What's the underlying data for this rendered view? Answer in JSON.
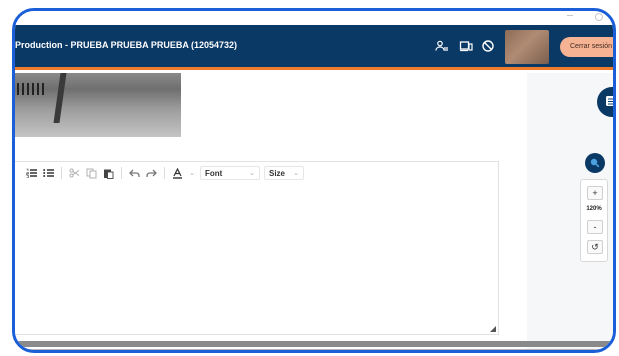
{
  "header": {
    "title": "Production - PRUEBA PRUEBA PRUEBA (12054732)",
    "logout_label": "Cerrar sesión",
    "icons": [
      "users-icon",
      "devices-icon",
      "block-icon"
    ]
  },
  "editor": {
    "toolbar": {
      "font_label": "Font",
      "size_label": "Size",
      "icons": [
        "numbered-list-icon",
        "bulleted-list-icon",
        "cut-icon",
        "copy-icon",
        "paste-icon",
        "undo-icon",
        "redo-icon",
        "text-color-icon"
      ]
    }
  },
  "zoom": {
    "plus": "+",
    "level": "120%",
    "minus": "-",
    "reset": "↺"
  },
  "colors": {
    "header_bg": "#0b3966",
    "accent_orange": "#f07a2c",
    "logout_bg": "#f6b394",
    "frame_border": "#1a5fd8"
  }
}
